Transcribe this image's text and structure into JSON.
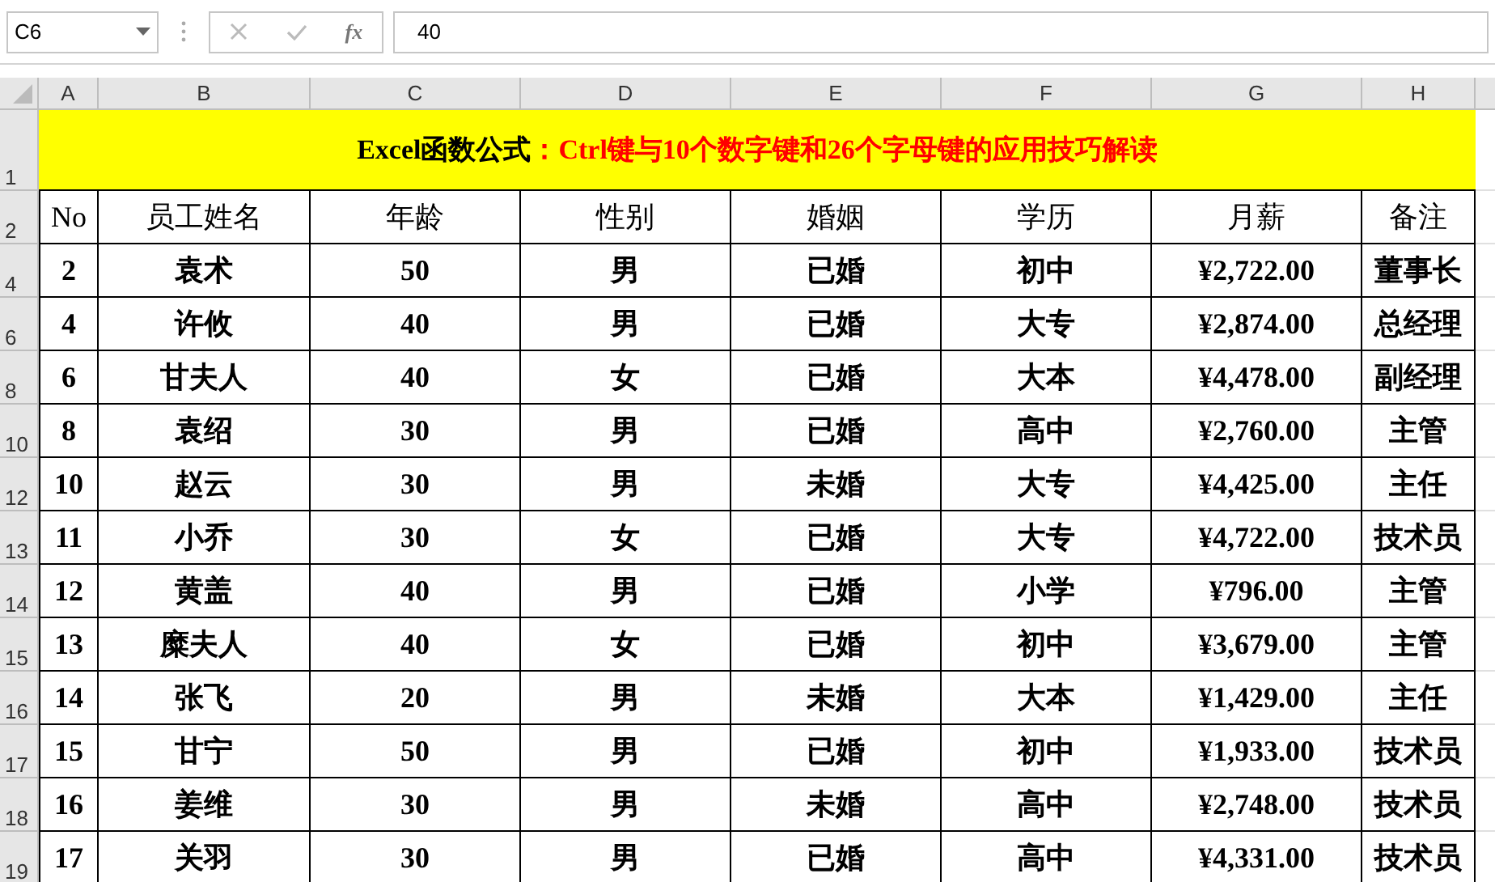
{
  "formula_bar": {
    "name_box": "C6",
    "function_button": "fx",
    "value": "40"
  },
  "column_headers": [
    "A",
    "B",
    "C",
    "D",
    "E",
    "F",
    "G",
    "H"
  ],
  "title_row": {
    "row_number": "1",
    "lead": "Excel函数公式",
    "rest": "：Ctrl键与10个数字键和26个字母键的应用技巧解读"
  },
  "header_row": {
    "row_number": "2",
    "cells": [
      "No",
      "员工姓名",
      "年龄",
      "性别",
      "婚姻",
      "学历",
      "月薪",
      "备注"
    ]
  },
  "rows": [
    {
      "row_number": "4",
      "cells": [
        "2",
        "袁术",
        "50",
        "男",
        "已婚",
        "初中",
        "¥2,722.00",
        "董事长"
      ]
    },
    {
      "row_number": "6",
      "cells": [
        "4",
        "许攸",
        "40",
        "男",
        "已婚",
        "大专",
        "¥2,874.00",
        "总经理"
      ]
    },
    {
      "row_number": "8",
      "cells": [
        "6",
        "甘夫人",
        "40",
        "女",
        "已婚",
        "大本",
        "¥4,478.00",
        "副经理"
      ]
    },
    {
      "row_number": "10",
      "cells": [
        "8",
        "袁绍",
        "30",
        "男",
        "已婚",
        "高中",
        "¥2,760.00",
        "主管"
      ]
    },
    {
      "row_number": "12",
      "cells": [
        "10",
        "赵云",
        "30",
        "男",
        "未婚",
        "大专",
        "¥4,425.00",
        "主任"
      ]
    },
    {
      "row_number": "13",
      "cells": [
        "11",
        "小乔",
        "30",
        "女",
        "已婚",
        "大专",
        "¥4,722.00",
        "技术员"
      ]
    },
    {
      "row_number": "14",
      "cells": [
        "12",
        "黄盖",
        "40",
        "男",
        "已婚",
        "小学",
        "¥796.00",
        "主管"
      ]
    },
    {
      "row_number": "15",
      "cells": [
        "13",
        "糜夫人",
        "40",
        "女",
        "已婚",
        "初中",
        "¥3,679.00",
        "主管"
      ]
    },
    {
      "row_number": "16",
      "cells": [
        "14",
        "张飞",
        "20",
        "男",
        "未婚",
        "大本",
        "¥1,429.00",
        "主任"
      ]
    },
    {
      "row_number": "17",
      "cells": [
        "15",
        "甘宁",
        "50",
        "男",
        "已婚",
        "初中",
        "¥1,933.00",
        "技术员"
      ]
    },
    {
      "row_number": "18",
      "cells": [
        "16",
        "姜维",
        "30",
        "男",
        "未婚",
        "高中",
        "¥2,748.00",
        "技术员"
      ]
    },
    {
      "row_number": "19",
      "cells": [
        "17",
        "关羽",
        "30",
        "男",
        "已婚",
        "高中",
        "¥4,331.00",
        "技术员"
      ]
    }
  ]
}
